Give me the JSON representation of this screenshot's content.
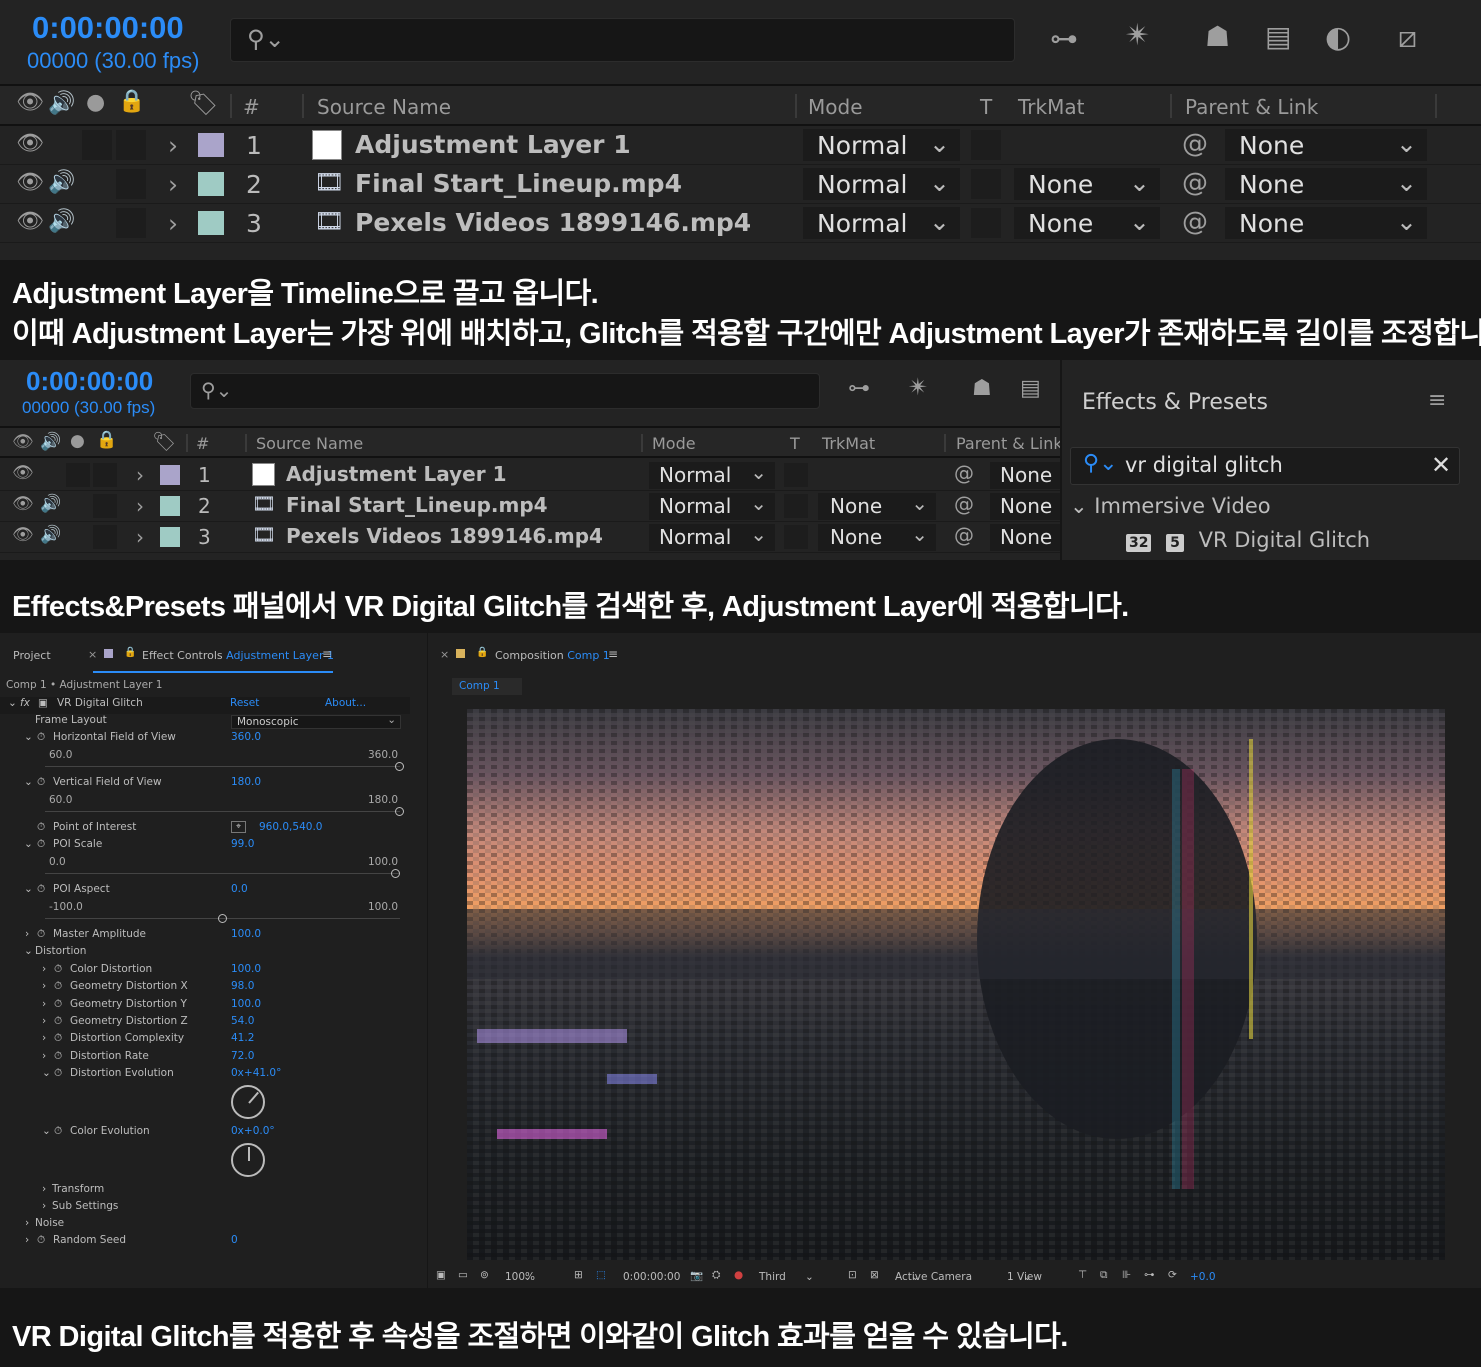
{
  "colors": {
    "accent": "#2b8cf7",
    "label_lavender": "#aaa4ca",
    "label_aqua": "#9fcbc4"
  },
  "timeline1": {
    "timecode": "0:00:00:00",
    "fps": "00000 (30.00 fps)",
    "columns": {
      "number": "#",
      "source": "Source Name",
      "mode": "Mode",
      "t": "T",
      "trkmat": "TrkMat",
      "parent": "Parent & Link"
    },
    "layers": [
      {
        "num": "1",
        "name": "Adjustment Layer 1",
        "mode": "Normal",
        "trkmat": "",
        "parent": "None",
        "type": "adjustment"
      },
      {
        "num": "2",
        "name": "Final Start_Lineup.mp4",
        "mode": "Normal",
        "trkmat": "None",
        "parent": "None",
        "type": "footage"
      },
      {
        "num": "3",
        "name": "Pexels Videos 1899146.mp4",
        "mode": "Normal",
        "trkmat": "None",
        "parent": "None",
        "type": "footage"
      }
    ]
  },
  "caption1": {
    "line1": "Adjustment Layer을 Timeline으로 끌고 옵니다.",
    "line2": "이때 Adjustment Layer는 가장 위에 배치하고, Glitch를 적용할 구간에만 Adjustment Layer가 존재하도록 길이를 조정합니다."
  },
  "timeline2": {
    "timecode": "0:00:00:00",
    "fps": "00000 (30.00 fps)",
    "columns": {
      "number": "#",
      "source": "Source Name",
      "mode": "Mode",
      "t": "T",
      "trkmat": "TrkMat",
      "parent": "Parent & Link"
    },
    "layers": [
      {
        "num": "1",
        "name": "Adjustment Layer 1",
        "mode": "Normal",
        "trkmat": "",
        "parent": "None"
      },
      {
        "num": "2",
        "name": "Final Start_Lineup.mp4",
        "mode": "Normal",
        "trkmat": "None",
        "parent": "None"
      },
      {
        "num": "3",
        "name": "Pexels Videos 1899146.mp4",
        "mode": "Normal",
        "trkmat": "None",
        "parent": "None"
      }
    ]
  },
  "effects_presets": {
    "title": "Effects & Presets",
    "search_value": "vr digital glitch",
    "category": "Immersive Video",
    "item": "VR Digital Glitch",
    "badge1": "32",
    "badge2": "5"
  },
  "caption2": "Effects&Presets 패널에서 VR Digital Glitch를 검색한 후, Adjustment Layer에 적용합니다.",
  "effect_controls": {
    "tab_project": "Project",
    "tab_prefix": "Effect Controls",
    "tab_layer": "Adjustment Layer 1",
    "breadcrumb": "Comp 1 • Adjustment Layer 1",
    "effect_name": "VR Digital Glitch",
    "reset": "Reset",
    "about": "About...",
    "frame_layout_label": "Frame Layout",
    "frame_layout_value": "Monoscopic",
    "hfov": {
      "label": "Horizontal Field of View",
      "value": "360.0",
      "min": "60.0",
      "max": "360.0",
      "level": 1.0
    },
    "vfov": {
      "label": "Vertical Field of View",
      "value": "180.0",
      "min": "60.0",
      "max": "180.0",
      "level": 1.0
    },
    "poi": {
      "label": "Point of Interest",
      "value": "960.0,540.0"
    },
    "poi_scale": {
      "label": "POI Scale",
      "value": "99.0",
      "min": "0.0",
      "max": "100.0",
      "level": 0.99
    },
    "poi_aspect": {
      "label": "POI Aspect",
      "value": "0.0",
      "min": "-100.0",
      "max": "100.0",
      "level": 0.5
    },
    "master_amp": {
      "label": "Master Amplitude",
      "value": "100.0"
    },
    "distortion": "Distortion",
    "dist_items": [
      {
        "label": "Color Distortion",
        "value": "100.0"
      },
      {
        "label": "Geometry Distortion X",
        "value": "98.0"
      },
      {
        "label": "Geometry Distortion Y",
        "value": "100.0"
      },
      {
        "label": "Geometry Distortion Z",
        "value": "54.0"
      },
      {
        "label": "Distortion Complexity",
        "value": "41.2"
      },
      {
        "label": "Distortion Rate",
        "value": "72.0"
      }
    ],
    "dist_evolution": {
      "label": "Distortion Evolution",
      "value": "0x+41.0°",
      "angle": 41
    },
    "color_evolution": {
      "label": "Color Evolution",
      "value": "0x+0.0°",
      "angle": 0
    },
    "transform": "Transform",
    "sub_settings": "Sub Settings",
    "noise": "Noise",
    "random_seed": {
      "label": "Random Seed",
      "value": "0"
    }
  },
  "composition": {
    "tab_prefix": "Composition",
    "tab_comp": "Comp 1",
    "subtab": "Comp 1",
    "zoom": "100%",
    "time": "0:00:00:00",
    "resolution": "Third",
    "camera": "Active Camera",
    "views": "1 View",
    "exposure": "+0.0"
  },
  "caption3": "VR Digital Glitch를 적용한 후 속성을 조절하면 이와같이 Glitch 효과를 얻을 수 있습니다."
}
